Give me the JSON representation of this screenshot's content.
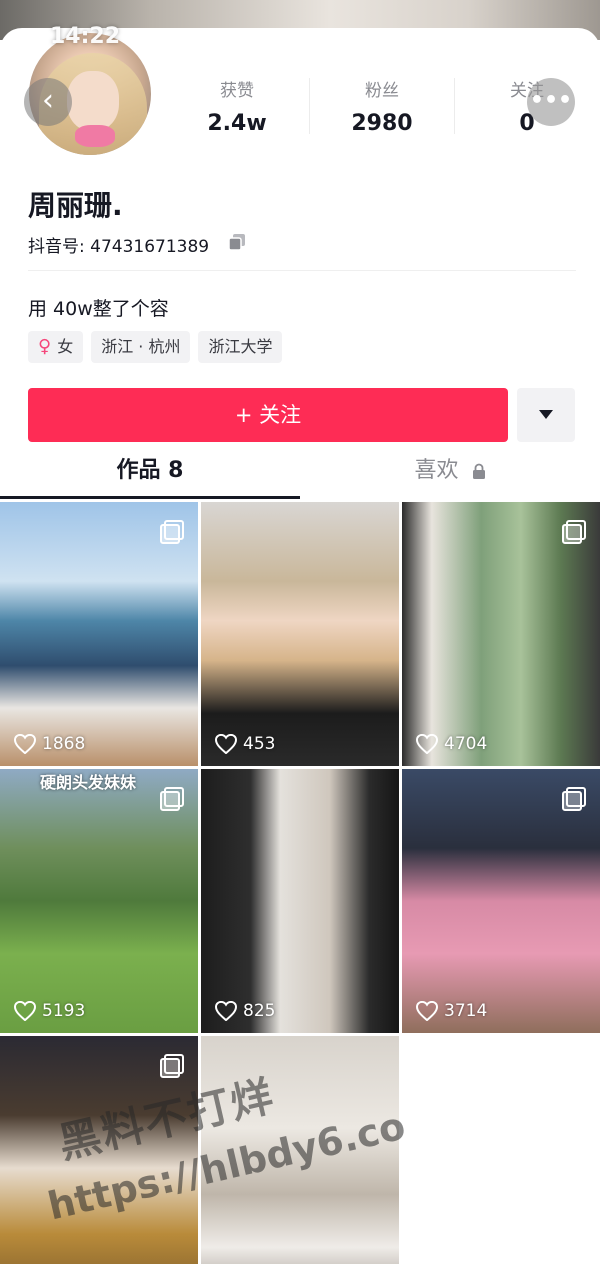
{
  "status_bar": {
    "time": "14:22"
  },
  "profile": {
    "name": "周丽珊.",
    "douyin_id": "抖音号: 47431671389",
    "bio": "用 40w整了个容",
    "tags": [
      {
        "label": "女",
        "icon": "female-icon"
      },
      {
        "label": "浙江 · 杭州"
      },
      {
        "label": "浙江大学"
      }
    ]
  },
  "stats": [
    {
      "label": "获赞",
      "value": "2.4w"
    },
    {
      "label": "粉丝",
      "value": "2980"
    },
    {
      "label": "关注",
      "value": "0"
    }
  ],
  "actions": {
    "follow_label": "+ 关注",
    "back_icon": "chevron-left-icon",
    "more_icon": "more-icon",
    "dropdown_icon": "triangle-down-icon"
  },
  "tabs": [
    {
      "label": "作品 8",
      "active": true
    },
    {
      "label": "喜欢",
      "locked": true
    }
  ],
  "posts": [
    {
      "likes": "1868",
      "multi_image": true
    },
    {
      "likes": "453",
      "multi_image": false
    },
    {
      "likes": "4704",
      "multi_image": true
    },
    {
      "likes": "5193",
      "multi_image": true,
      "caption": "硬朗头发妹妹"
    },
    {
      "likes": "825",
      "multi_image": false
    },
    {
      "likes": "3714",
      "multi_image": true
    },
    {
      "multi_image": true
    },
    {
      "multi_image": false
    }
  ],
  "watermark": {
    "line1": "黑料不打烊",
    "line2": "https://hlbdy6.co"
  },
  "colors": {
    "accent": "#fe2c55",
    "text": "#161823",
    "muted": "#8a8b91"
  }
}
